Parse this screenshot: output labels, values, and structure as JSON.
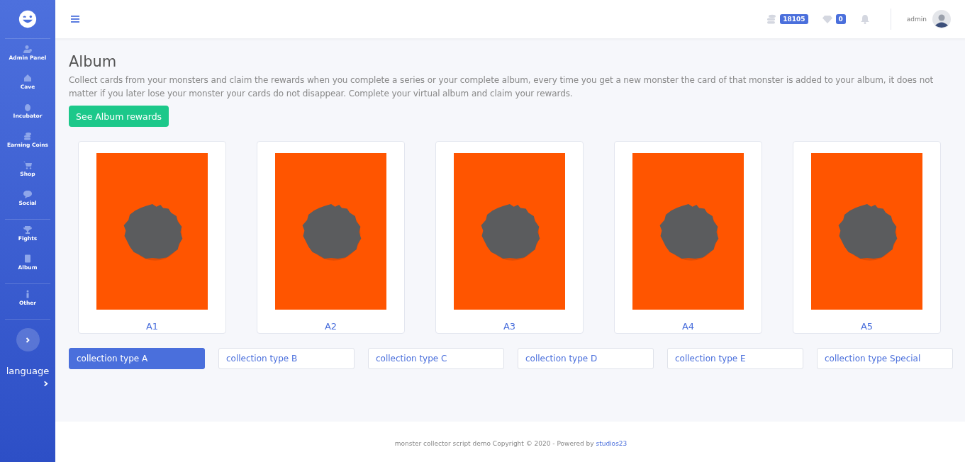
{
  "sidebar": {
    "groups": [
      {
        "items": [
          {
            "label": "Admin Panel",
            "kind": "user"
          },
          {
            "label": "Cave",
            "kind": "house"
          },
          {
            "label": "Incubator",
            "kind": "egg"
          },
          {
            "label": "Earning Coins",
            "kind": "coins"
          },
          {
            "label": "Shop",
            "kind": "cart"
          },
          {
            "label": "Social",
            "kind": "chat"
          }
        ]
      },
      {
        "items": [
          {
            "label": "Fights",
            "kind": "trophy"
          },
          {
            "label": "Album",
            "kind": "book"
          }
        ]
      },
      {
        "items": [
          {
            "label": "Other",
            "kind": "info"
          }
        ]
      }
    ],
    "language": "language"
  },
  "topbar": {
    "coins": "18105",
    "gems": "0",
    "user": "admin"
  },
  "page": {
    "title": "Album",
    "description": "Collect cards from your monsters and claim the rewards when you complete a series or your complete album, every time you get a new monster the card of that monster is added to your album, it does not matter if you later lose your monster your cards do not disappear. Complete your virtual album and claim your rewards.",
    "rewards_button": "See Album rewards"
  },
  "cards": [
    {
      "label": "A1"
    },
    {
      "label": "A2"
    },
    {
      "label": "A3"
    },
    {
      "label": "A4"
    },
    {
      "label": "A5"
    }
  ],
  "collection_tabs": [
    {
      "label": "collection type A",
      "selected": true
    },
    {
      "label": "collection type B",
      "selected": false
    },
    {
      "label": "collection type C",
      "selected": false
    },
    {
      "label": "collection type D",
      "selected": false
    },
    {
      "label": "collection type E",
      "selected": false
    },
    {
      "label": "collection type Special",
      "selected": false
    }
  ],
  "footer": {
    "text": "monster collector script demo Copyright © 2020 - Powered by",
    "link": "studios23"
  }
}
